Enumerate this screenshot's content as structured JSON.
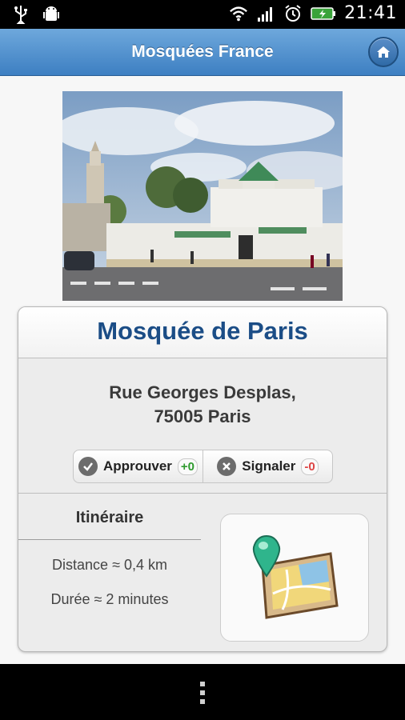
{
  "status_bar": {
    "time": "21:41",
    "left_icons": [
      "usb-icon",
      "android-debug-icon"
    ],
    "right_icons": [
      "wifi-icon",
      "signal-icon",
      "alarm-icon",
      "battery-charging-icon"
    ]
  },
  "app_bar": {
    "title": "Mosquées France",
    "home_icon": "home-icon"
  },
  "mosque": {
    "name": "Mosquée de Paris",
    "address_line1": "Rue Georges Desplas,",
    "address_line2": "75005 Paris"
  },
  "vote": {
    "approve_label": "Approuver",
    "approve_count": "+0",
    "report_label": "Signaler",
    "report_count": "-0"
  },
  "itinerary": {
    "title": "Itinéraire",
    "distance": "Distance ≈ 0,4 km",
    "duration": "Durée ≈ 2 minutes",
    "map_icon": "map-icon"
  },
  "colors": {
    "header_top": "#6ea8dc",
    "header_bottom": "#3d7fc2",
    "mosque_name": "#1b4d86",
    "positive": "#2e9a2e",
    "negative": "#dd4444"
  }
}
